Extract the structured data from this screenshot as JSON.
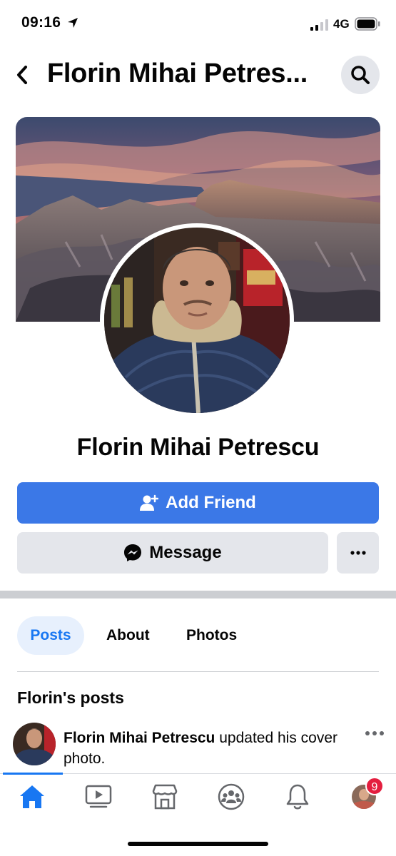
{
  "status_bar": {
    "time": "09:16",
    "network": "4G"
  },
  "header": {
    "title": "Florin Mihai Petres..."
  },
  "profile": {
    "name": "Florin Mihai Petrescu"
  },
  "actions": {
    "add_friend": "Add Friend",
    "message": "Message"
  },
  "tabs": [
    {
      "label": "Posts",
      "active": true
    },
    {
      "label": "About",
      "active": false
    },
    {
      "label": "Photos",
      "active": false
    }
  ],
  "posts_section": {
    "title": "Florin's posts"
  },
  "post": {
    "author": "Florin Mihai Petrescu",
    "action": " updated his cover photo."
  },
  "bottom_nav": {
    "items": [
      "home-icon",
      "watch-icon",
      "marketplace-icon",
      "groups-icon",
      "notifications-icon",
      "profile-avatar"
    ],
    "active": "home-icon",
    "notification_badge": "9"
  },
  "colors": {
    "accent": "#1877f2",
    "primary_button": "#3b78e7",
    "secondary_button": "#e4e6eb",
    "badge": "#e41e3f"
  }
}
